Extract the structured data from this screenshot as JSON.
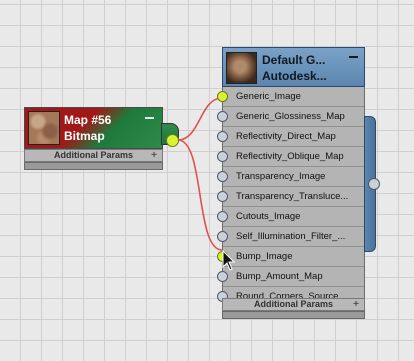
{
  "map_node": {
    "title": "Map #56",
    "subtitle": "Bitmap",
    "params_label": "Additional Params",
    "plus": "+"
  },
  "material_node": {
    "title": "Default G...",
    "subtitle": "Autodesk...",
    "params_label": "Additional Params",
    "plus": "+",
    "slots": [
      {
        "label": "Generic_Image",
        "connected": true
      },
      {
        "label": "Generic_Glossiness_Map",
        "connected": false
      },
      {
        "label": "Reflectivity_Direct_Map",
        "connected": false
      },
      {
        "label": "Reflectivity_Oblique_Map",
        "connected": false
      },
      {
        "label": "Transparency_Image",
        "connected": false
      },
      {
        "label": "Transparency_Transluce...",
        "connected": false
      },
      {
        "label": "Cutouts_Image",
        "connected": false
      },
      {
        "label": "Self_Illumination_Filter_...",
        "connected": false
      },
      {
        "label": "Bump_Image",
        "connected": true
      },
      {
        "label": "Bump_Amount_Map",
        "connected": false
      },
      {
        "label": "Round_Corners_Source...",
        "connected": false
      }
    ]
  },
  "colors": {
    "wire": "#e05050",
    "active_socket": "#d9f235"
  }
}
